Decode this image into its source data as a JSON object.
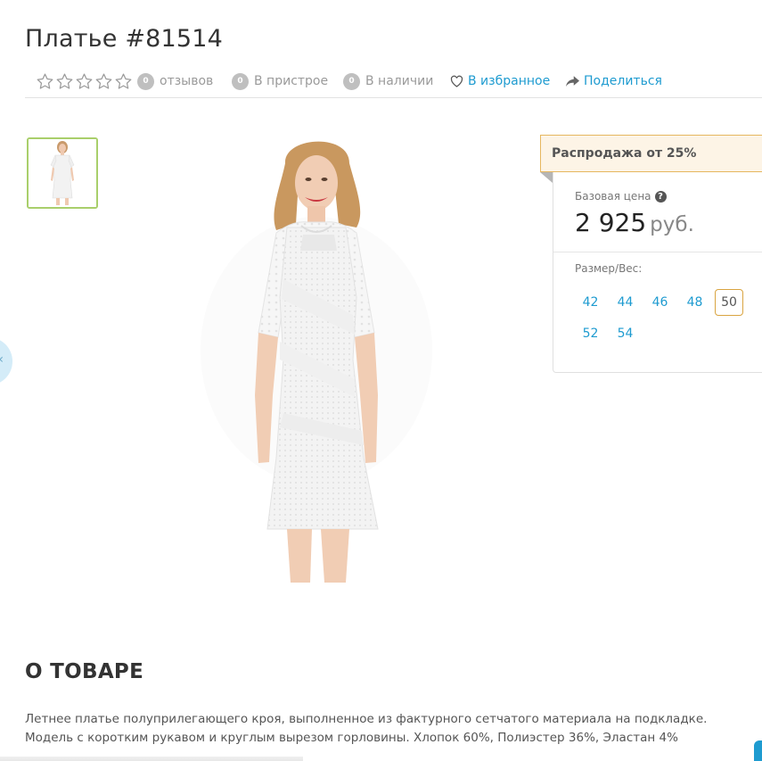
{
  "product": {
    "title": "Платье #81514"
  },
  "meta": {
    "rating_stars": 5,
    "reviews_count": "0",
    "reviews_label": "отзывов",
    "preorder_count": "0",
    "preorder_label": "В пристрое",
    "stock_count": "0",
    "stock_label": "В наличии",
    "favorite_label": "В избранное",
    "share_label": "Поделиться"
  },
  "offer": {
    "sale_label": "Распродажа от 25%",
    "base_price_label": "Базовая цена",
    "help_glyph": "?",
    "price": "2 925",
    "currency": "руб.",
    "size_label": "Размер/Вес:",
    "sizes": [
      "42",
      "44",
      "46",
      "48",
      "50",
      "52",
      "54"
    ],
    "selected_size": "50"
  },
  "about": {
    "heading": "О ТОВАРЕ",
    "description": "Летнее платье полуприлегающего кроя, выполненное из фактурного сетчатого материала на подкладке. Модель с коротким рукавом и круглым вырезом горловины. Хлопок 60%, Полиэстер 36%, Эластан 4%"
  },
  "icons": {
    "star": "star-outline-icon",
    "heart": "heart-outline-icon",
    "share": "share-arrow-icon",
    "help": "question-circle-icon",
    "side_tab": "chevron-left-icon"
  },
  "colors": {
    "link": "#1e9bd0",
    "sale_border": "#e6b75f",
    "sale_bg": "#fdf4e6",
    "thumb_border": "#a9cf6b",
    "selected_size_border": "#d9a441"
  }
}
